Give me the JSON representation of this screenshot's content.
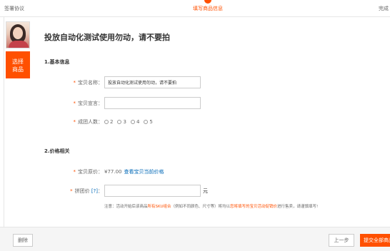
{
  "steps": {
    "step1": "签署协议",
    "step2": "填写商品信息",
    "step3": "完成"
  },
  "sidebar": {
    "select_label_line1": "选择",
    "select_label_line2": "商品"
  },
  "main": {
    "title": "投放自动化测试使用勿动，请不要拍",
    "section1": "1.基本信息",
    "section2": "2.价格相关",
    "name_label": "宝贝名称：",
    "name_value": "投放自动化测试使用勿动，请不要拍",
    "slogan_label": "宝贝宣言：",
    "slogan_value": "",
    "group_label": "成团人数：",
    "group_options": [
      "2",
      "3",
      "4",
      "5"
    ],
    "price_label": "宝贝原价：",
    "price_value": "¥77.00",
    "price_link": "查看宝贝当前价格",
    "group_price_label": "拼团价",
    "group_price_hint": "[?]",
    "group_price_value": "",
    "unit": "元",
    "note_prefix": "注意：活动开始后该商品",
    "note_red1": "所有SKU组合",
    "note_mid": "（例如不同颜色、尺寸等）将均以",
    "note_red2": "您将填写的宝贝活动促销价",
    "note_suffix": "进行售卖，请谨慎填写!"
  },
  "footer": {
    "delete": "删除",
    "prev": "上一步",
    "submit": "提交全部商品"
  },
  "colors": {
    "accent": "#ff5000",
    "link": "#0068b7"
  }
}
